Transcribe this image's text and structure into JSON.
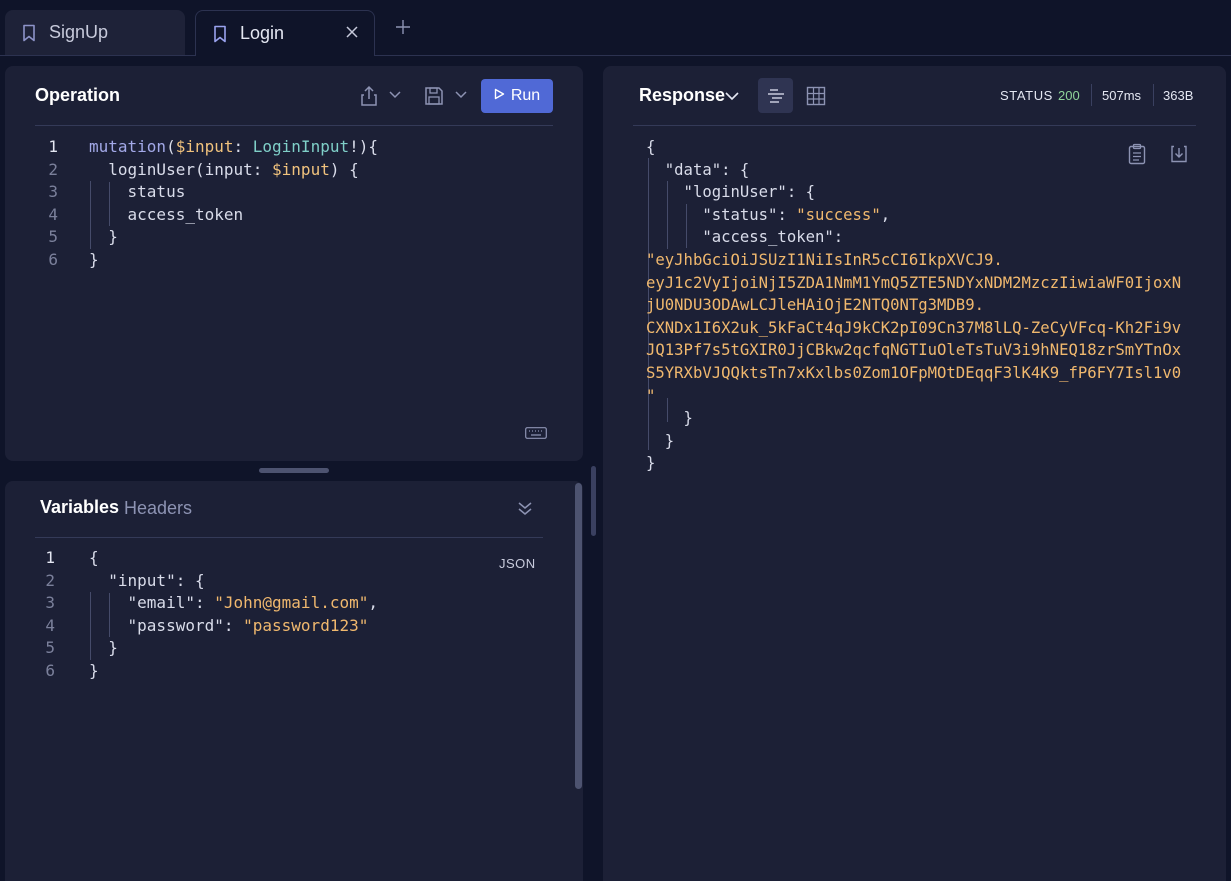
{
  "tabs": [
    {
      "label": "SignUp",
      "icon": "bookmark-icon"
    },
    {
      "label": "Login",
      "icon": "bookmark-icon"
    }
  ],
  "operation": {
    "title": "Operation",
    "run_label": "Run",
    "line_numbers": [
      "1",
      "2",
      "3",
      "4",
      "5",
      "6"
    ],
    "lines": [
      {
        "parts": [
          [
            "mutation",
            "k-keyword"
          ],
          [
            "(",
            "k-punct"
          ],
          [
            "$input",
            "k-var"
          ],
          [
            ": ",
            "k-punct"
          ],
          [
            "LoginInput",
            "k-type"
          ],
          [
            "!){",
            "k-punct"
          ]
        ]
      },
      {
        "parts": [
          [
            "  loginUser",
            "k-field"
          ],
          [
            "(input: ",
            "k-punct"
          ],
          [
            "$input",
            "k-var"
          ],
          [
            ") {",
            "k-punct"
          ]
        ]
      },
      {
        "parts": [
          [
            "    status",
            "k-field"
          ]
        ]
      },
      {
        "parts": [
          [
            "    access_token",
            "k-field"
          ]
        ]
      },
      {
        "parts": [
          [
            "  }",
            "k-punct"
          ]
        ]
      },
      {
        "parts": [
          [
            "}",
            "k-punct"
          ]
        ]
      }
    ]
  },
  "variables": {
    "tab_variables": "Variables",
    "tab_headers": "Headers",
    "format_label": "JSON",
    "line_numbers": [
      "1",
      "2",
      "3",
      "4",
      "5",
      "6"
    ],
    "lines": [
      {
        "parts": [
          [
            "{",
            "k-punct"
          ]
        ]
      },
      {
        "parts": [
          [
            "  \"input\"",
            "k-key"
          ],
          [
            ": {",
            "k-punct"
          ]
        ]
      },
      {
        "parts": [
          [
            "    \"email\"",
            "k-key"
          ],
          [
            ": ",
            "k-punct"
          ],
          [
            "\"John@gmail.com\"",
            "k-str"
          ],
          [
            ",",
            "k-punct"
          ]
        ]
      },
      {
        "parts": [
          [
            "    \"password\"",
            "k-key"
          ],
          [
            ": ",
            "k-punct"
          ],
          [
            "\"password123\"",
            "k-str"
          ]
        ]
      },
      {
        "parts": [
          [
            "  }",
            "k-punct"
          ]
        ]
      },
      {
        "parts": [
          [
            "}",
            "k-punct"
          ]
        ]
      }
    ]
  },
  "response": {
    "title": "Response",
    "status_label": "STATUS",
    "status_code": "200",
    "time": "507ms",
    "size": "363B",
    "lines": [
      {
        "parts": [
          [
            "{",
            "k-punct"
          ]
        ]
      },
      {
        "parts": [
          [
            "  \"data\"",
            "k-key"
          ],
          [
            ": {",
            "k-punct"
          ]
        ]
      },
      {
        "parts": [
          [
            "    \"loginUser\"",
            "k-key"
          ],
          [
            ": {",
            "k-punct"
          ]
        ]
      },
      {
        "parts": [
          [
            "      \"status\"",
            "k-key"
          ],
          [
            ": ",
            "k-punct"
          ],
          [
            "\"success\"",
            "k-str"
          ],
          [
            ",",
            "k-punct"
          ]
        ]
      },
      {
        "parts": [
          [
            "      \"access_token\"",
            "k-key"
          ],
          [
            ":",
            "k-punct"
          ]
        ]
      },
      {
        "parts": [
          [
            "\"eyJhbGciOiJSUzI1NiIsInR5cCI6IkpXVCJ9.",
            "k-str"
          ]
        ]
      },
      {
        "parts": [
          [
            "eyJ1c2VyIjoiNjI5ZDA1NmM1YmQ5ZTE5NDYxNDM2MzczIiwiaWF0IjoxN",
            "k-str"
          ]
        ]
      },
      {
        "parts": [
          [
            "jU0NDU3ODAwLCJleHAiOjE2NTQ0NTg3MDB9.",
            "k-str"
          ]
        ]
      },
      {
        "parts": [
          [
            "CXNDx1I6X2uk_5kFaCt4qJ9kCK2pI09Cn37M8lLQ-ZeCyVFcq-Kh2Fi9v",
            "k-str"
          ]
        ]
      },
      {
        "parts": [
          [
            "JQ13Pf7s5tGXIR0JjCBkw2qcfqNGTIuOleTsTuV3i9hNEQ18zrSmYTnOx",
            "k-str"
          ]
        ]
      },
      {
        "parts": [
          [
            "S5YRXbVJQQktsTn7xKxlbs0Zom1OFpMOtDEqqF3lK4K9_fP6FY7Isl1v0",
            "k-str"
          ]
        ]
      },
      {
        "parts": [
          [
            "\"",
            "k-str"
          ]
        ]
      },
      {
        "parts": [
          [
            "    }",
            "k-punct"
          ]
        ]
      },
      {
        "parts": [
          [
            "  }",
            "k-punct"
          ]
        ]
      },
      {
        "parts": [
          [
            "}",
            "k-punct"
          ]
        ]
      }
    ]
  }
}
